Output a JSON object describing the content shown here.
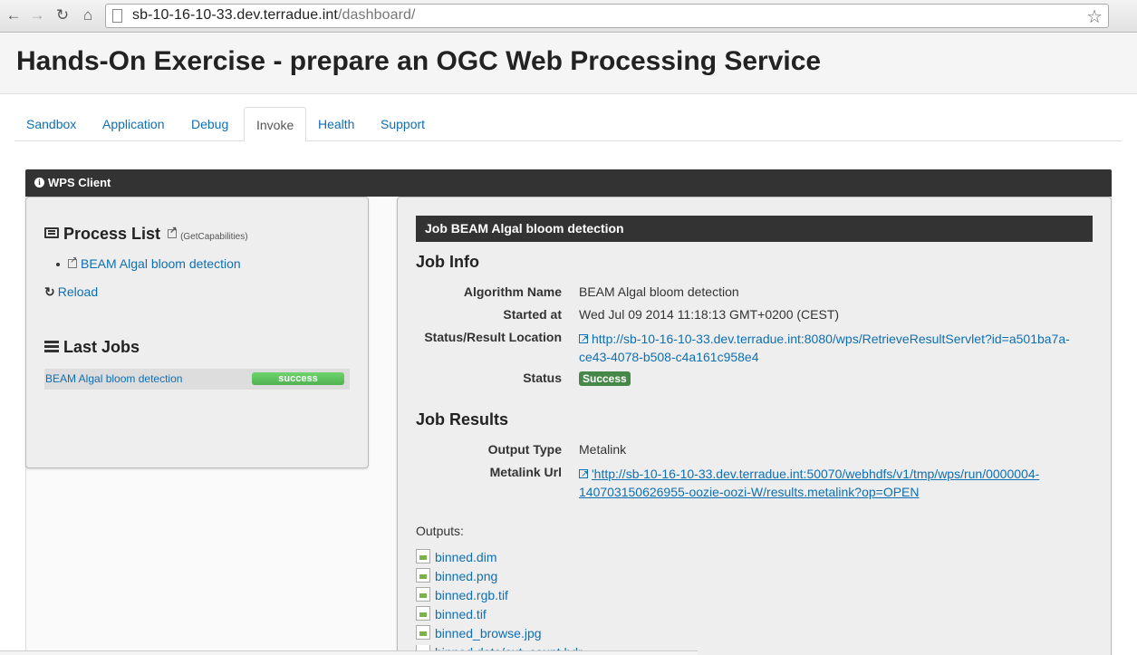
{
  "browser": {
    "url_host": "sb-10-16-10-33.dev.terradue.int",
    "url_path": "/dashboard/"
  },
  "header": {
    "title": "Hands-On Exercise - prepare an OGC Web Processing Service"
  },
  "tabs": [
    {
      "label": "Sandbox"
    },
    {
      "label": "Application"
    },
    {
      "label": "Debug"
    },
    {
      "label": "Invoke"
    },
    {
      "label": "Health"
    },
    {
      "label": "Support"
    }
  ],
  "active_tab": "Invoke",
  "wps": {
    "title": "WPS Client"
  },
  "process_list": {
    "title": "Process List",
    "getcap_label": "(GetCapabilities)",
    "items": [
      {
        "label": "BEAM Algal bloom detection"
      }
    ],
    "reload_label": "Reload"
  },
  "last_jobs": {
    "title": "Last Jobs",
    "jobs": [
      {
        "name": "BEAM Algal bloom detection",
        "status": "success"
      }
    ]
  },
  "job": {
    "title": "Job BEAM Algal bloom detection",
    "info_title": "Job Info",
    "algorithm_label": "Algorithm Name",
    "algorithm_value": "BEAM Algal bloom detection",
    "started_label": "Started at",
    "started_value": "Wed Jul 09 2014 11:18:13 GMT+0200 (CEST)",
    "location_label": "Status/Result Location",
    "location_line1": "http://sb-10-16-10-33.dev.terradue.int:8080/wps/RetrieveResultServlet?id=a501ba7a-",
    "location_line2": "ce43-4078-b508-c4a161c958e4",
    "status_label": "Status",
    "status_value": "Success",
    "results_title": "Job Results",
    "output_type_label": "Output Type",
    "output_type_value": "Metalink",
    "metalink_label": "Metalink Url",
    "metalink_line1": "'http://sb-10-16-10-33.dev.terradue.int:50070/webhdfs/v1/tmp/wps/run/0000004-",
    "metalink_line2": "140703150626955-oozie-oozi-W/results.metalink?op=OPEN",
    "outputs_label": "Outputs:",
    "outputs": [
      "binned.dim",
      "binned.png",
      "binned.rgb.tif",
      "binned.tif",
      "binned_browse.jpg",
      "binned.data/out_count.hdr"
    ]
  },
  "colors": {
    "link": "#0f6fb3",
    "dark_bar": "#333333",
    "success_badge": "#468847",
    "success_bar": "#5cb85c"
  }
}
